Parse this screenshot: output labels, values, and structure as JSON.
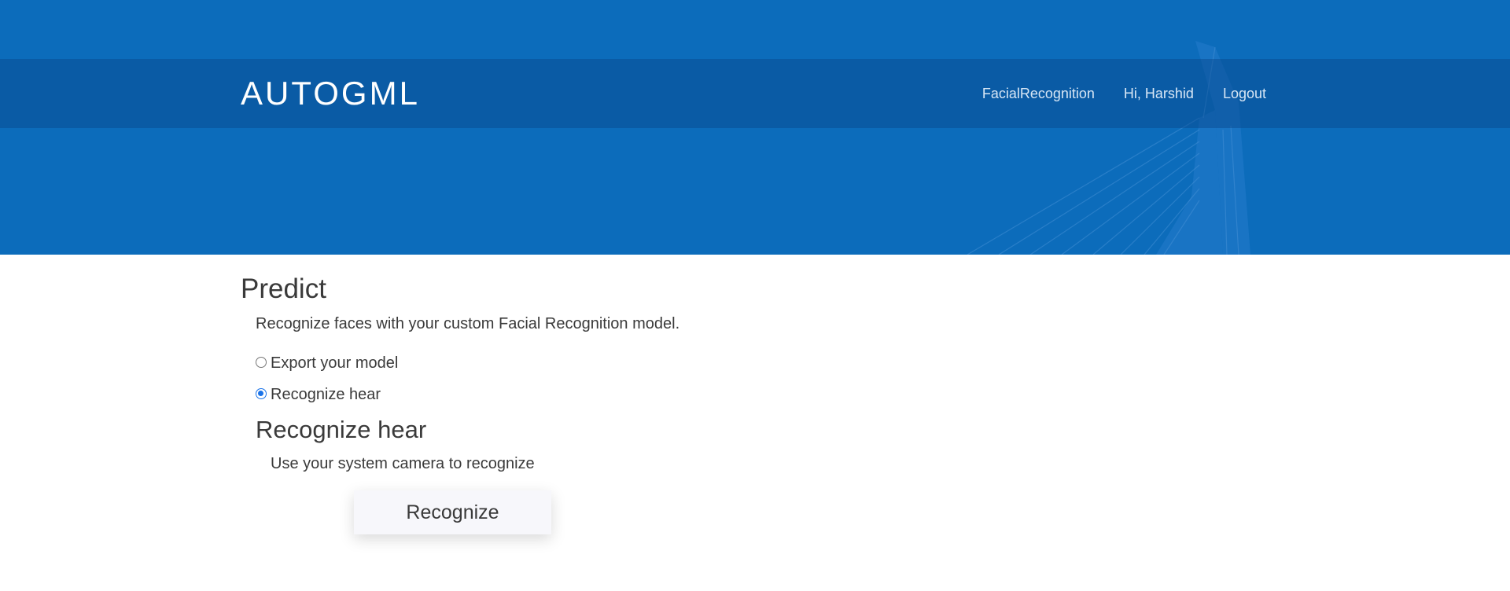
{
  "header": {
    "brand": "AUTOGML",
    "nav": {
      "facial_recognition": "FacialRecognition",
      "greeting": "Hi, Harshid",
      "logout": "Logout"
    }
  },
  "main": {
    "title": "Predict",
    "subtitle": "Recognize faces with your custom Facial Recognition model.",
    "options": [
      {
        "label": "Export your model",
        "checked": false
      },
      {
        "label": "Recognize hear",
        "checked": true
      }
    ],
    "section": {
      "title": "Recognize hear",
      "description": "Use your system camera to recognize",
      "button_label": "Recognize"
    }
  },
  "colors": {
    "header_bg": "#0c6cbb",
    "accent": "#1a73e8"
  }
}
